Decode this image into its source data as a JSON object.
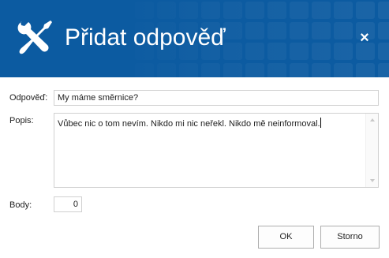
{
  "header": {
    "title": "Přidat odpověď",
    "close_symbol": "×",
    "icon": "tools-icon",
    "color": "#0c5ba1"
  },
  "form": {
    "answer_label": "Odpověď:",
    "answer_value": "My máme směrnice?",
    "description_label": "Popis:",
    "description_value": "Vůbec nic o tom nevím. Nikdo mi nic neřekl. Nikdo mě neinformoval.",
    "points_label": "Body:",
    "points_value": "0"
  },
  "buttons": {
    "ok_label": "OK",
    "cancel_label": "Storno"
  }
}
